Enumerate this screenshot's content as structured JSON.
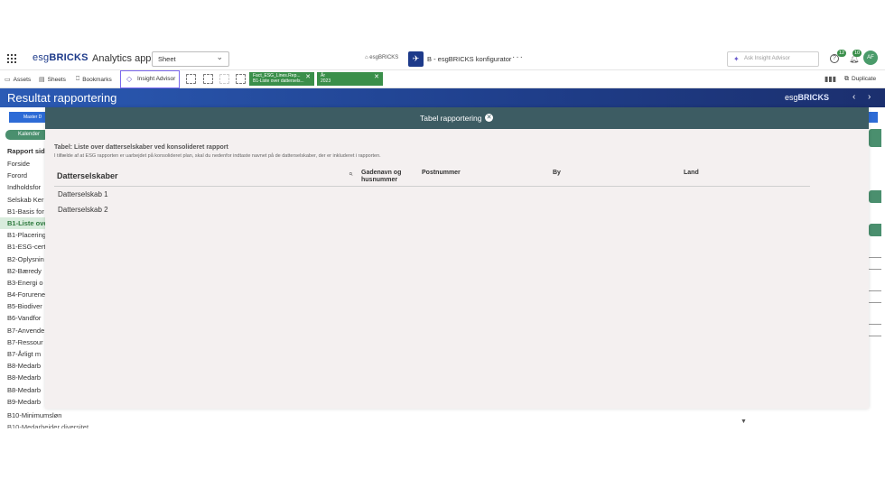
{
  "app": {
    "logo_prefix": "esg",
    "logo_bold": "BRICKS",
    "title": "Analytics app",
    "sheet_select": "Sheet",
    "space_label": "esgBRICKS",
    "center_app_name": "B - esgBRICKS konfigurator",
    "more": "···",
    "ask_placeholder": "Ask Insight Advisor",
    "help_badge": "12",
    "notif_badge": "10",
    "avatar_initials": "AF"
  },
  "toolbar": {
    "assets": "Assets",
    "sheets": "Sheets",
    "bookmarks": "Bookmarks",
    "insight_advisor": "Insight Advisor",
    "duplicate": "Duplicate",
    "chips": [
      {
        "field": "Fact_ESG_Lines.Rep...",
        "value": "B1-Liste over dattersels..."
      },
      {
        "field": "År",
        "value": "2023"
      }
    ]
  },
  "titlebar": {
    "title": "Resultat rapportering",
    "brand_prefix": "esg",
    "brand_bold": "BRICKS",
    "prev": "‹",
    "next": "›"
  },
  "sheet": {
    "master_button": "Master D",
    "kalender_button": "Kalender",
    "list_header": "Rapport sid",
    "items": [
      "Forside",
      "Forord",
      "Indholdsfor",
      "Selskab Ker",
      "B1-Basis for",
      "B1-Liste ove",
      "B1-Placering",
      "B1-ESG-cert",
      "B2-Oplysnin",
      "B2-Bæredy",
      "B3-Energi o",
      "B4-Forurene",
      "B5-Biodiver",
      "B6-Vandfor",
      "B7-Anvende",
      "B7-Ressour",
      "B7-Årligt m",
      "B8-Medarb",
      "B8-Medarb",
      "B8-Medarb",
      "B9-Medarb"
    ],
    "active_index": 5,
    "bottom_item": "B10-Minimumsløn",
    "bottom_item2": "B10-Medarbejder diversitet"
  },
  "modal": {
    "title": "Tabel rapportering",
    "subtitle": "Tabel: Liste over datterselskaber ved konsolideret rapport",
    "description": "I tilfælde af at ESG rapporten er uarbejdet på konsolideret plan, skal du nedenfor indtaste navnet på de datterselskaber, der er inkluderet i rapporten.",
    "columns": {
      "main": "Datterselskaber",
      "address_line1": "Gadenavn og",
      "address_line2": "husnummer",
      "postal": "Postnummer",
      "city": "By",
      "country": "Land"
    },
    "rows": [
      "Datterselskab 1",
      "Datterselskab 2"
    ]
  }
}
